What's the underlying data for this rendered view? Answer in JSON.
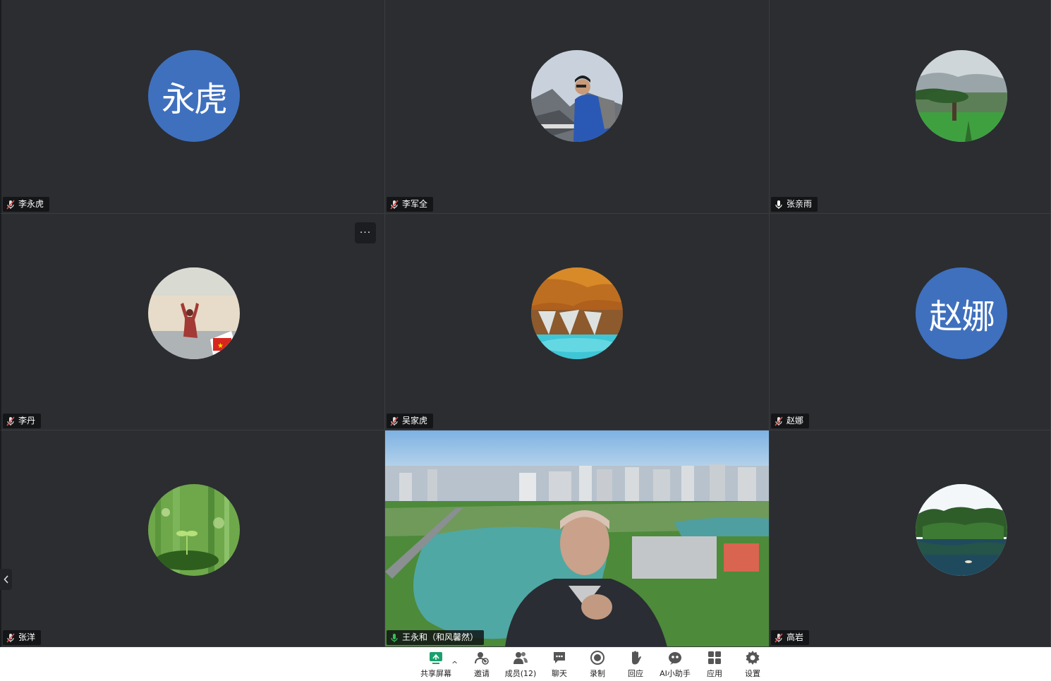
{
  "participants": [
    {
      "name": "李永虎",
      "initials": "永虎",
      "mic": "muted"
    },
    {
      "name": "李军全",
      "mic": "muted"
    },
    {
      "name": "张亲雨",
      "mic": "on"
    },
    {
      "name": "李丹",
      "mic": "muted"
    },
    {
      "name": "吴家虎",
      "mic": "muted"
    },
    {
      "name": "赵娜",
      "initials": "赵娜",
      "mic": "muted"
    },
    {
      "name": "张洋",
      "mic": "muted"
    },
    {
      "name": "王永和（和风馨然）",
      "mic": "active"
    },
    {
      "name": "高岩",
      "mic": "muted"
    }
  ],
  "tile_menu": {
    "label": "···"
  },
  "toolbar": {
    "share": "共享屏幕",
    "invite": "邀请",
    "members": "成员(12)",
    "chat": "聊天",
    "record": "录制",
    "reaction": "回应",
    "ai": "AI小助手",
    "apps": "应用",
    "settings": "设置",
    "caret": "^"
  },
  "colors": {
    "tile_bg": "#2b2d31",
    "avatar_blue": "#3f70be",
    "mic_muted": "#e0504f",
    "mic_active": "#3bbf5a",
    "share_green": "#1aa06d"
  }
}
